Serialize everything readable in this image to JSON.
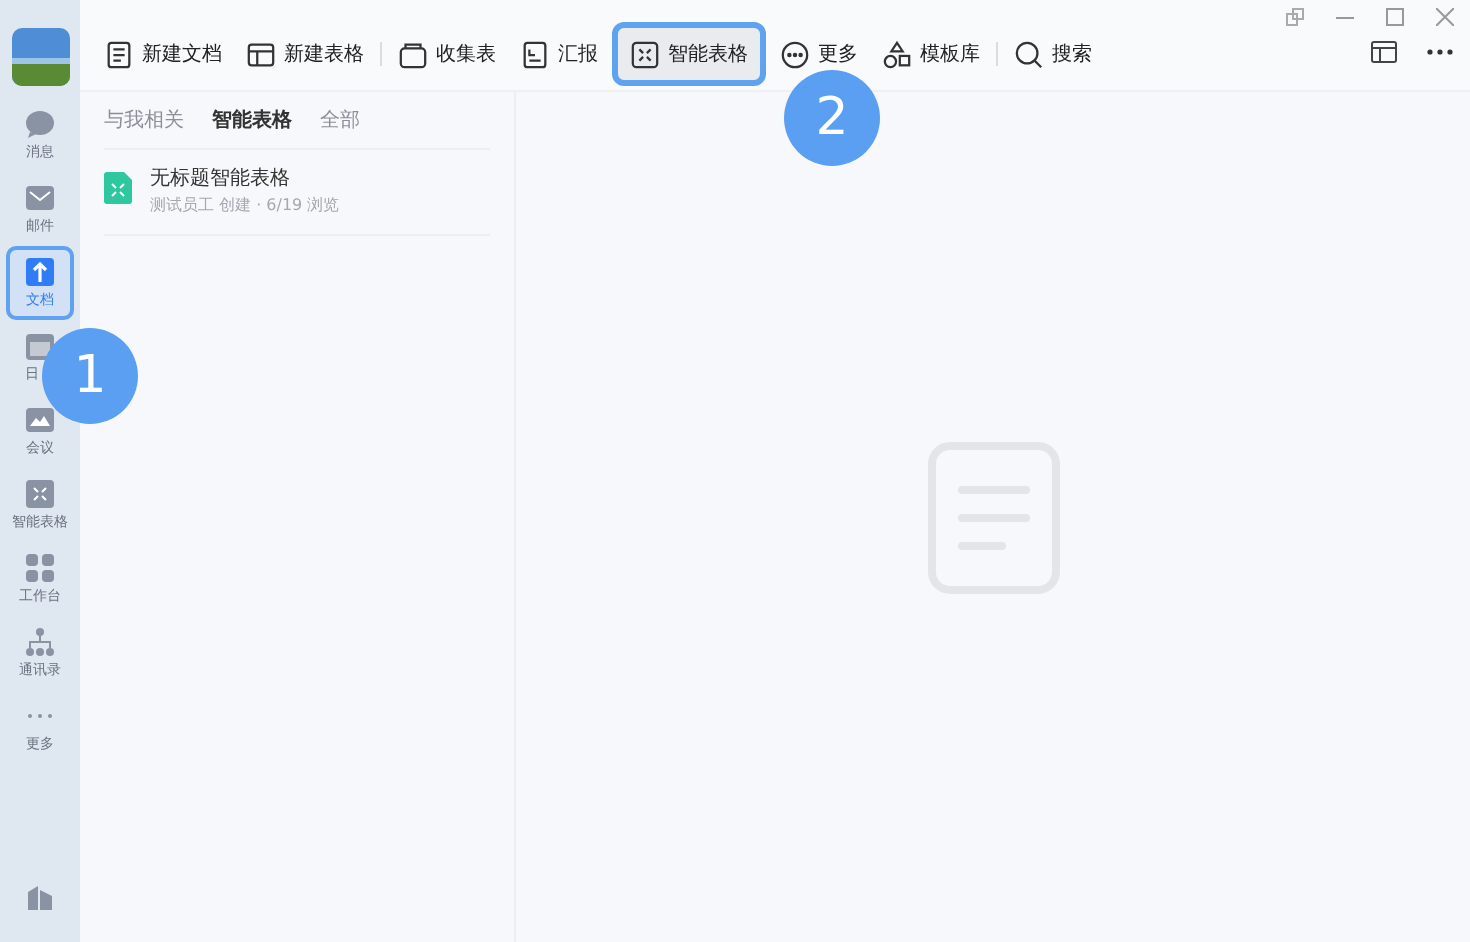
{
  "sidebar": {
    "items": [
      {
        "kind": "chat",
        "label": "消息",
        "selected": false
      },
      {
        "kind": "mail",
        "label": "邮件",
        "selected": false
      },
      {
        "kind": "doc",
        "label": "文档",
        "selected": true
      },
      {
        "kind": "calendar",
        "label": "日",
        "selected": false
      },
      {
        "kind": "meeting",
        "label": "会议",
        "selected": false
      },
      {
        "kind": "smart",
        "label": "智能表格",
        "selected": false
      },
      {
        "kind": "apps",
        "label": "工作台",
        "selected": false
      },
      {
        "kind": "contacts",
        "label": "通讯录",
        "selected": false
      },
      {
        "kind": "more",
        "label": "更多",
        "selected": false
      }
    ]
  },
  "toolbar": {
    "buttons": [
      {
        "kind": "doc",
        "label": "新建文档",
        "highlighted": false
      },
      {
        "kind": "sheet",
        "label": "新建表格",
        "highlighted": false
      },
      {
        "kind": "divider"
      },
      {
        "kind": "bag",
        "label": "收集表",
        "highlighted": false
      },
      {
        "kind": "report",
        "label": "汇报",
        "highlighted": false
      },
      {
        "kind": "smart",
        "label": "智能表格",
        "highlighted": true
      },
      {
        "kind": "more",
        "label": "更多",
        "highlighted": false
      },
      {
        "kind": "shapes",
        "label": "模板库",
        "highlighted": false
      },
      {
        "kind": "divider"
      },
      {
        "kind": "search",
        "label": "搜索",
        "highlighted": false
      }
    ]
  },
  "list_panel": {
    "tabs": [
      {
        "label": "与我相关",
        "selected": false
      },
      {
        "label": "智能表格",
        "selected": true
      },
      {
        "label": "全部",
        "selected": false
      }
    ],
    "files": [
      {
        "title": "无标题智能表格",
        "subtitle": "测试员工 创建 · 6/19 浏览"
      }
    ]
  },
  "annotations": [
    {
      "number": "1"
    },
    {
      "number": "2"
    }
  ]
}
